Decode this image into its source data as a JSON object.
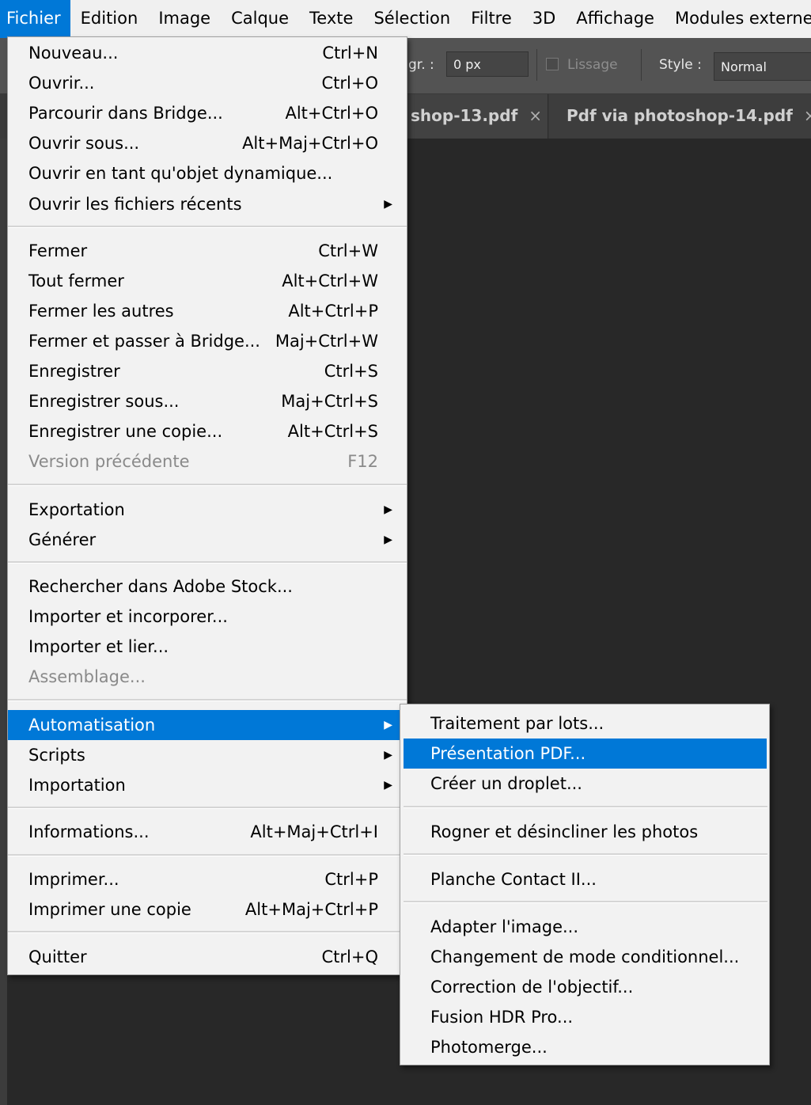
{
  "menubar": {
    "items": [
      "Fichier",
      "Edition",
      "Image",
      "Calque",
      "Texte",
      "Sélection",
      "Filtre",
      "3D",
      "Affichage",
      "Modules externes"
    ]
  },
  "options_bar": {
    "feather_label": "gr. :",
    "feather_value": "0 px",
    "antialias_label": "Lissage",
    "style_label": "Style :",
    "style_value": "Normal"
  },
  "tabs": [
    {
      "label": "shop-13.pdf",
      "close": "×"
    },
    {
      "label": "Pdf via photoshop-14.pdf",
      "close": "×"
    }
  ],
  "file_menu": {
    "items": [
      {
        "label": "Nouveau...",
        "shortcut": "Ctrl+N"
      },
      {
        "label": "Ouvrir...",
        "shortcut": "Ctrl+O"
      },
      {
        "label": "Parcourir dans Bridge...",
        "shortcut": "Alt+Ctrl+O"
      },
      {
        "label": "Ouvrir sous...",
        "shortcut": "Alt+Maj+Ctrl+O"
      },
      {
        "label": "Ouvrir en tant qu'objet dynamique...",
        "shortcut": ""
      },
      {
        "label": "Ouvrir les fichiers récents",
        "shortcut": "",
        "submenu": true
      },
      {
        "label": "Fermer",
        "shortcut": "Ctrl+W"
      },
      {
        "label": "Tout fermer",
        "shortcut": "Alt+Ctrl+W"
      },
      {
        "label": "Fermer les autres",
        "shortcut": "Alt+Ctrl+P"
      },
      {
        "label": "Fermer et passer à Bridge...",
        "shortcut": "Maj+Ctrl+W"
      },
      {
        "label": "Enregistrer",
        "shortcut": "Ctrl+S"
      },
      {
        "label": "Enregistrer sous...",
        "shortcut": "Maj+Ctrl+S"
      },
      {
        "label": "Enregistrer une copie...",
        "shortcut": "Alt+Ctrl+S"
      },
      {
        "label": "Version précédente",
        "shortcut": "F12",
        "disabled": true
      },
      {
        "label": "Exportation",
        "shortcut": "",
        "submenu": true
      },
      {
        "label": "Générer",
        "shortcut": "",
        "submenu": true
      },
      {
        "label": "Rechercher dans Adobe Stock...",
        "shortcut": ""
      },
      {
        "label": "Importer et incorporer...",
        "shortcut": ""
      },
      {
        "label": "Importer et lier...",
        "shortcut": ""
      },
      {
        "label": "Assemblage...",
        "shortcut": "",
        "disabled": true
      },
      {
        "label": "Automatisation",
        "shortcut": "",
        "submenu": true,
        "highlighted": true
      },
      {
        "label": "Scripts",
        "shortcut": "",
        "submenu": true
      },
      {
        "label": "Importation",
        "shortcut": "",
        "submenu": true
      },
      {
        "label": "Informations...",
        "shortcut": "Alt+Maj+Ctrl+I"
      },
      {
        "label": "Imprimer...",
        "shortcut": "Ctrl+P"
      },
      {
        "label": "Imprimer une copie",
        "shortcut": "Alt+Maj+Ctrl+P"
      },
      {
        "label": "Quitter",
        "shortcut": "Ctrl+Q"
      }
    ]
  },
  "automation_submenu": {
    "items": [
      {
        "label": "Traitement par lots..."
      },
      {
        "label": "Présentation PDF...",
        "highlighted": true
      },
      {
        "label": "Créer un droplet..."
      },
      {
        "label": "Rogner et désincliner les photos"
      },
      {
        "label": "Planche Contact II..."
      },
      {
        "label": "Adapter l'image..."
      },
      {
        "label": "Changement de mode conditionnel..."
      },
      {
        "label": "Correction de l'objectif..."
      },
      {
        "label": "Fusion HDR Pro..."
      },
      {
        "label": "Photomerge..."
      }
    ]
  },
  "colors": {
    "highlight": "#0078d7",
    "menu_bg": "#f2f2f2",
    "workspace": "#282828"
  },
  "icons": {
    "submenu_arrow": "▶"
  }
}
